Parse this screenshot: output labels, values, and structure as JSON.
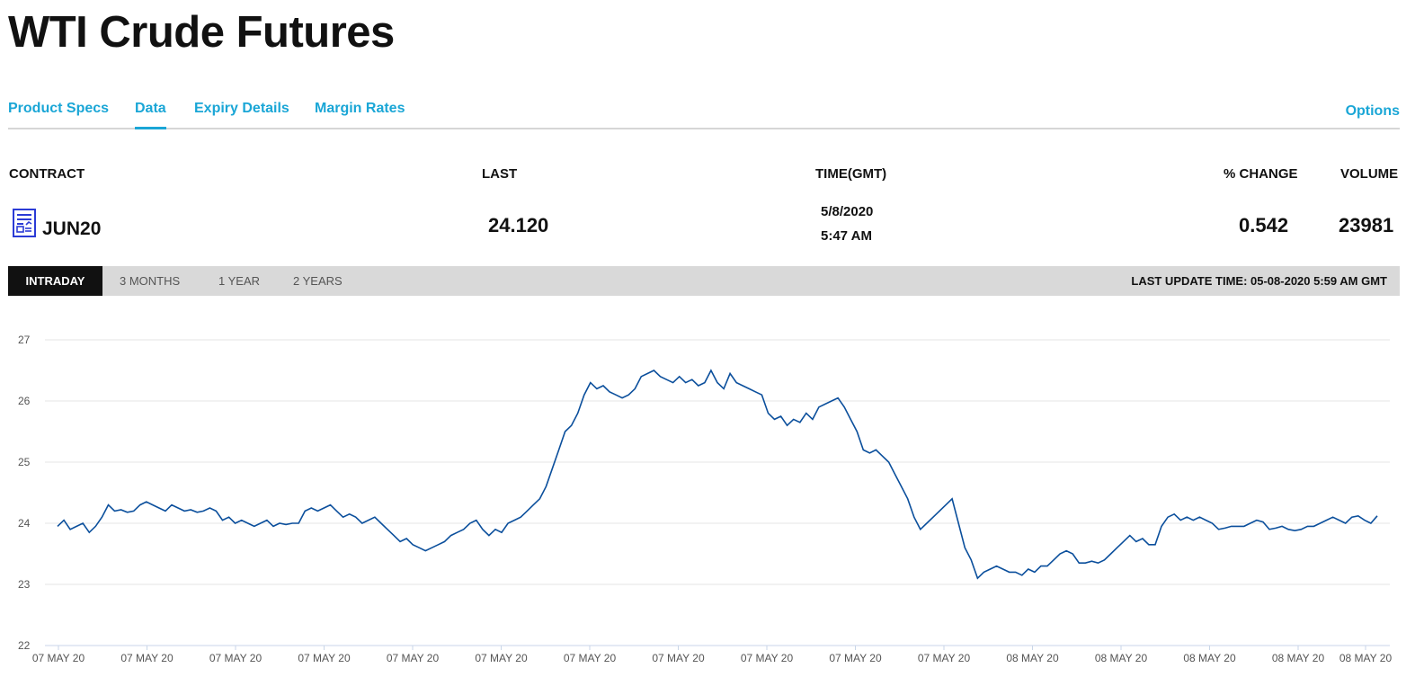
{
  "page": {
    "title": "WTI Crude Futures"
  },
  "tabs": {
    "items": [
      "Product Specs",
      "Data",
      "Expiry Details",
      "Margin Rates"
    ],
    "active": "Data",
    "options_label": "Options"
  },
  "table": {
    "headers": {
      "contract": "CONTRACT",
      "last": "LAST",
      "time": "TIME(GMT)",
      "change": "% CHANGE",
      "volume": "VOLUME"
    },
    "row": {
      "contract": "JUN20",
      "last": "24.120",
      "date": "5/8/2020",
      "time": "5:47 AM",
      "change": "0.542",
      "volume": "23981"
    }
  },
  "range": {
    "items": [
      "INTRADAY",
      "3 MONTHS",
      "1 YEAR",
      "2 YEARS"
    ],
    "active": "INTRADAY",
    "last_update": "LAST UPDATE TIME: 05-08-2020 5:59 AM GMT"
  },
  "colors": {
    "accent": "#1aa6d6",
    "line": "#0b4f9c",
    "grid": "#e6e6e6"
  },
  "chart_data": {
    "type": "line",
    "ylim": [
      22,
      27
    ],
    "yticks": [
      22,
      23,
      24,
      25,
      26,
      27
    ],
    "xticklabels": [
      "07 MAY 20",
      "07 MAY 20",
      "07 MAY 20",
      "07 MAY 20",
      "07 MAY 20",
      "07 MAY 20",
      "07 MAY 20",
      "07 MAY 20",
      "07 MAY 20",
      "07 MAY 20",
      "07 MAY 20",
      "08 MAY 20",
      "08 MAY 20",
      "08 MAY 20",
      "08 MAY 20",
      "08 MAY 20"
    ],
    "grid": true,
    "series": [
      {
        "values": [
          23.95,
          24.05,
          23.9,
          23.95,
          24.0,
          23.85,
          23.95,
          24.1,
          24.3,
          24.2,
          24.22,
          24.18,
          24.2,
          24.3,
          24.35,
          24.3,
          24.25,
          24.2,
          24.3,
          24.25,
          24.2,
          24.22,
          24.18,
          24.2,
          24.25,
          24.2,
          24.05,
          24.1,
          24.0,
          24.05,
          24.0,
          23.95,
          24.0,
          24.05,
          23.95,
          24.0,
          23.98,
          24.0,
          24.0,
          24.2,
          24.25,
          24.2,
          24.25,
          24.3,
          24.2,
          24.1,
          24.15,
          24.1,
          24.0,
          24.05,
          24.1,
          24.0,
          23.9,
          23.8,
          23.7,
          23.75,
          23.65,
          23.6,
          23.55,
          23.6,
          23.65,
          23.7,
          23.8,
          23.85,
          23.9,
          24.0,
          24.05,
          23.9,
          23.8,
          23.9,
          23.85,
          24.0,
          24.05,
          24.1,
          24.2,
          24.3,
          24.4,
          24.6,
          24.9,
          25.2,
          25.5,
          25.6,
          25.8,
          26.1,
          26.3,
          26.2,
          26.25,
          26.15,
          26.1,
          26.05,
          26.1,
          26.2,
          26.4,
          26.45,
          26.5,
          26.4,
          26.35,
          26.3,
          26.4,
          26.3,
          26.35,
          26.25,
          26.3,
          26.5,
          26.3,
          26.2,
          26.45,
          26.3,
          26.25,
          26.2,
          26.15,
          26.1,
          25.8,
          25.7,
          25.75,
          25.6,
          25.7,
          25.65,
          25.8,
          25.7,
          25.9,
          25.95,
          26.0,
          26.05,
          25.9,
          25.7,
          25.5,
          25.2,
          25.15,
          25.2,
          25.1,
          25.0,
          24.8,
          24.6,
          24.4,
          24.1,
          23.9,
          24.0,
          24.1,
          24.2,
          24.3,
          24.4,
          24.0,
          23.6,
          23.4,
          23.1,
          23.2,
          23.25,
          23.3,
          23.25,
          23.2,
          23.2,
          23.15,
          23.25,
          23.2,
          23.3,
          23.3,
          23.4,
          23.5,
          23.55,
          23.5,
          23.35,
          23.35,
          23.38,
          23.35,
          23.4,
          23.5,
          23.6,
          23.7,
          23.8,
          23.7,
          23.75,
          23.65,
          23.65,
          23.95,
          24.1,
          24.15,
          24.05,
          24.1,
          24.05,
          24.1,
          24.05,
          24.0,
          23.9,
          23.92,
          23.95,
          23.95,
          23.95,
          24.0,
          24.05,
          24.02,
          23.9,
          23.92,
          23.95,
          23.9,
          23.88,
          23.9,
          23.95,
          23.95,
          24.0,
          24.05,
          24.1,
          24.05,
          24.0,
          24.1,
          24.12,
          24.05,
          24.0,
          24.12
        ]
      }
    ]
  }
}
